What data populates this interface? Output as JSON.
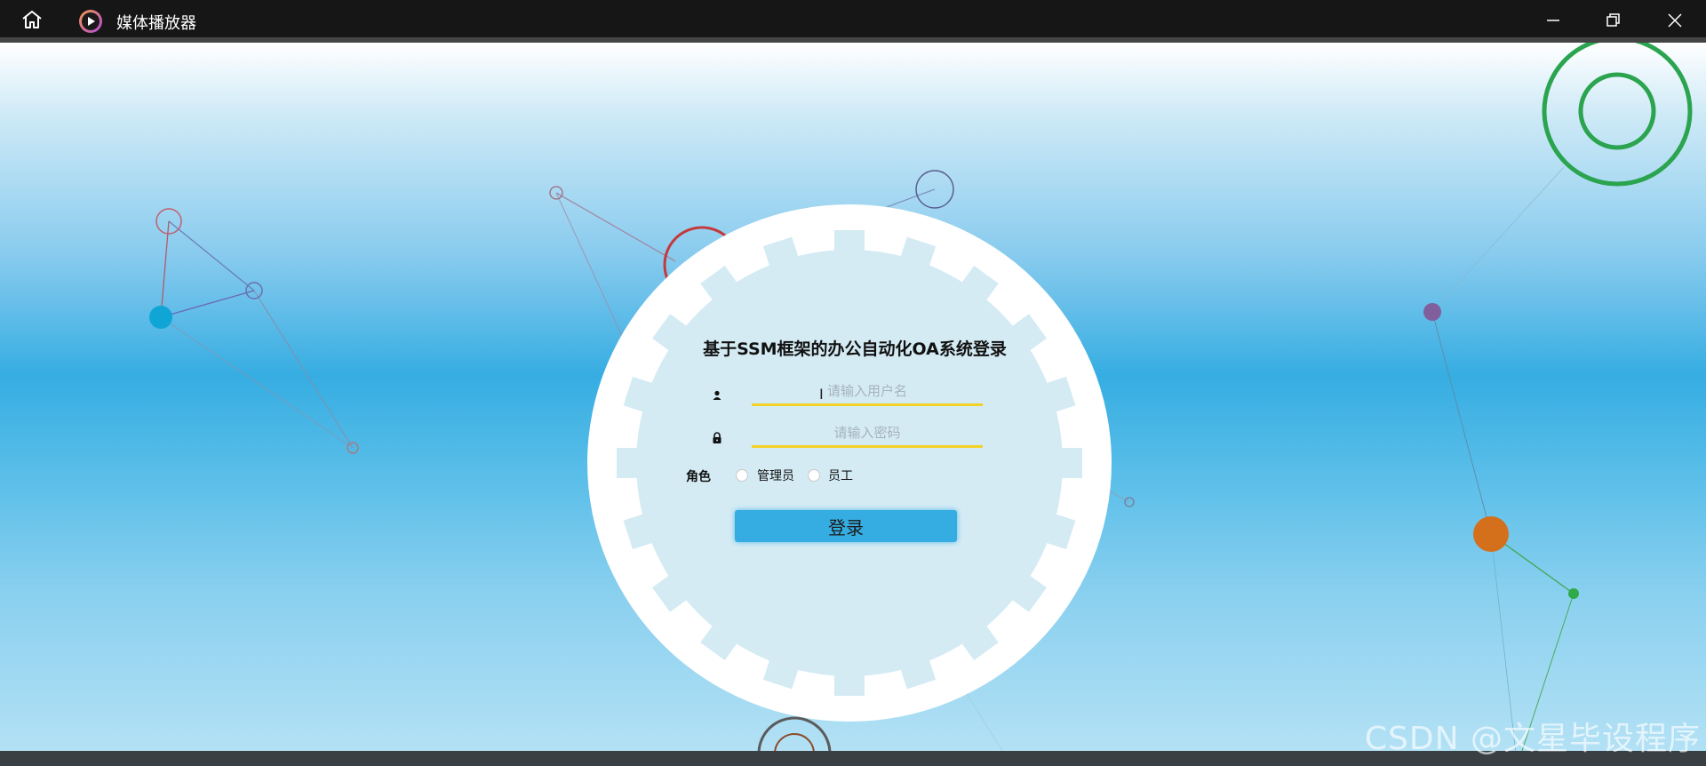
{
  "window": {
    "title": "媒体播放器",
    "icons": {
      "home": "home-icon",
      "app": "media-player-icon",
      "minimize": "minimize-icon",
      "restore": "restore-icon",
      "close": "close-icon"
    }
  },
  "login": {
    "title": "基于SSM框架的办公自动化OA系统登录",
    "username_placeholder": "请输入用户名",
    "password_placeholder": "请输入密码",
    "role_label": "角色",
    "roles": [
      "管理员",
      "员工"
    ],
    "submit_label": "登录"
  },
  "watermark": "CSDN @文星毕设程序",
  "colors": {
    "accent": "#36ade2",
    "underline": "#f3d126",
    "titlebar": "#161616"
  }
}
